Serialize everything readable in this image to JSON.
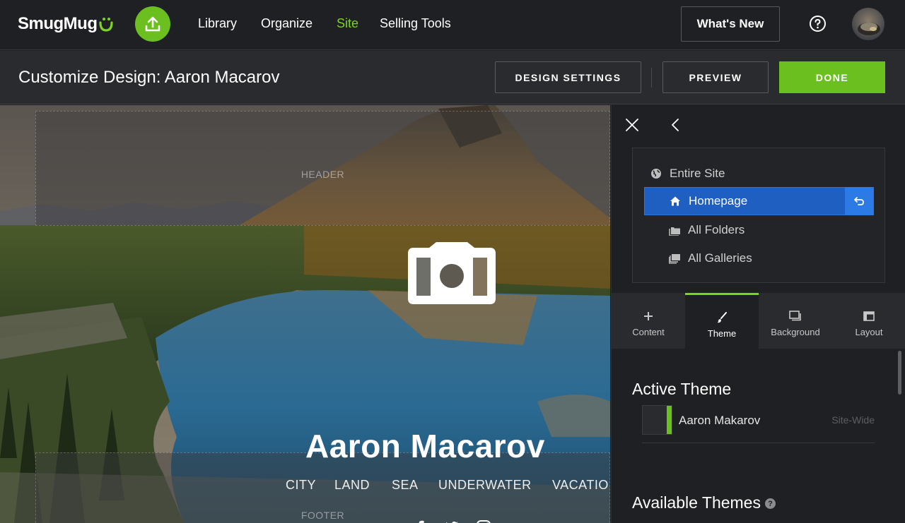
{
  "topnav": {
    "logo": "SmugMug",
    "links": [
      "Library",
      "Organize",
      "Site",
      "Selling Tools"
    ],
    "active_link": "Site",
    "whats_new": "What's New",
    "icons": {
      "upload": "upload-icon",
      "help": "help-circle-icon",
      "avatar": "user-avatar"
    }
  },
  "subheader": {
    "title": "Customize Design: Aaron Macarov",
    "design_settings": "DESIGN SETTINGS",
    "preview": "PREVIEW",
    "done": "DONE"
  },
  "preview": {
    "header_label": "HEADER",
    "footer_label": "FOOTER",
    "site_name": "Aaron Macarov",
    "nav": [
      "CITY",
      "LAND",
      "SEA",
      "UNDERWATER",
      "VACATIO"
    ],
    "social": [
      "facebook-icon",
      "twitter-icon",
      "instagram-icon"
    ]
  },
  "panel": {
    "scope": [
      {
        "label": "Entire Site",
        "icon": "globe-icon"
      },
      {
        "label": "Homepage",
        "icon": "home-icon",
        "selected": true
      },
      {
        "label": "All Folders",
        "icon": "folders-icon"
      },
      {
        "label": "All Galleries",
        "icon": "galleries-icon"
      }
    ],
    "tabs": [
      {
        "label": "Content",
        "icon": "plus-icon"
      },
      {
        "label": "Theme",
        "icon": "brush-icon",
        "active": true
      },
      {
        "label": "Background",
        "icon": "background-icon"
      },
      {
        "label": "Layout",
        "icon": "layout-icon"
      }
    ],
    "active_theme_title": "Active Theme",
    "active_theme": {
      "name": "Aaron Makarov",
      "scope": "Site-Wide"
    },
    "available_themes_title": "Available Themes"
  },
  "colors": {
    "accent_green": "#6bbf1f",
    "nav_active": "#7ed321",
    "select_blue": "#1f5fc1"
  }
}
